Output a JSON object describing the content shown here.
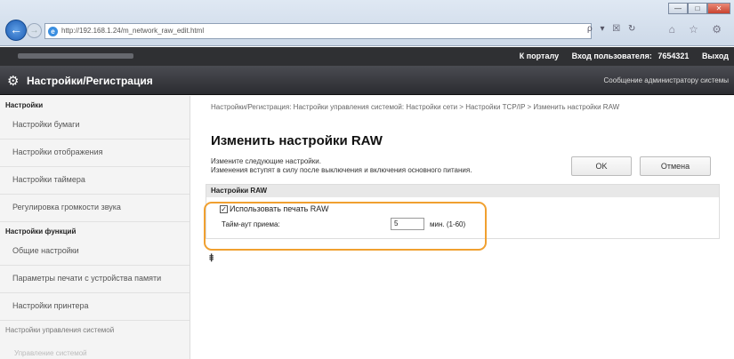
{
  "browser": {
    "url": "http://192.168.1.24/m_network_raw_edit.html",
    "window_buttons": [
      "—",
      "□",
      "✕"
    ],
    "address_tools": "ρ ▾ ☒ ↻",
    "toolbar_icons": "⌂ ☆ ⚙"
  },
  "topbar": {
    "links": [
      "К порталу",
      "Вход пользователя:",
      "7654321",
      "Выход"
    ]
  },
  "titlebar": {
    "title": "Настройки/Регистрация",
    "message": "Сообщение администратору системы",
    "icon": "gear-icon"
  },
  "sidebar": {
    "section1": "Настройки",
    "items1": [
      "Настройки бумаги",
      "Настройки отображения",
      "Настройки таймера",
      "Регулировка громкости звука"
    ],
    "section2": "Настройки функций",
    "items2": [
      "Общие настройки",
      "Параметры печати с устройства памяти",
      "Настройки принтера"
    ],
    "section3": "Настройки управления системой",
    "faded_item": "Управление системой"
  },
  "main": {
    "breadcrumb": "Настройки/Регистрация: Настройки управления системой: Настройки сети > Настройки TCP/IP > Изменить настройки RAW",
    "page_title": "Изменить настройки RAW",
    "note1": "Измените следующие настройки.",
    "note2": "Изменения вступят в силу после выключения и включения основного питания.",
    "ok_label": "OK",
    "cancel_label": "Отмена",
    "section_title": "Настройки RAW",
    "use_raw_label": "Использовать печать RAW",
    "use_raw_checked": true,
    "timeout_label": "Тайм-аут приема:",
    "timeout_value": "5",
    "timeout_unit": "мин. (1-60)",
    "to_top": "⯒"
  },
  "colors": {
    "highlight": "#f0a030",
    "title_bar": "#2b2c30"
  }
}
